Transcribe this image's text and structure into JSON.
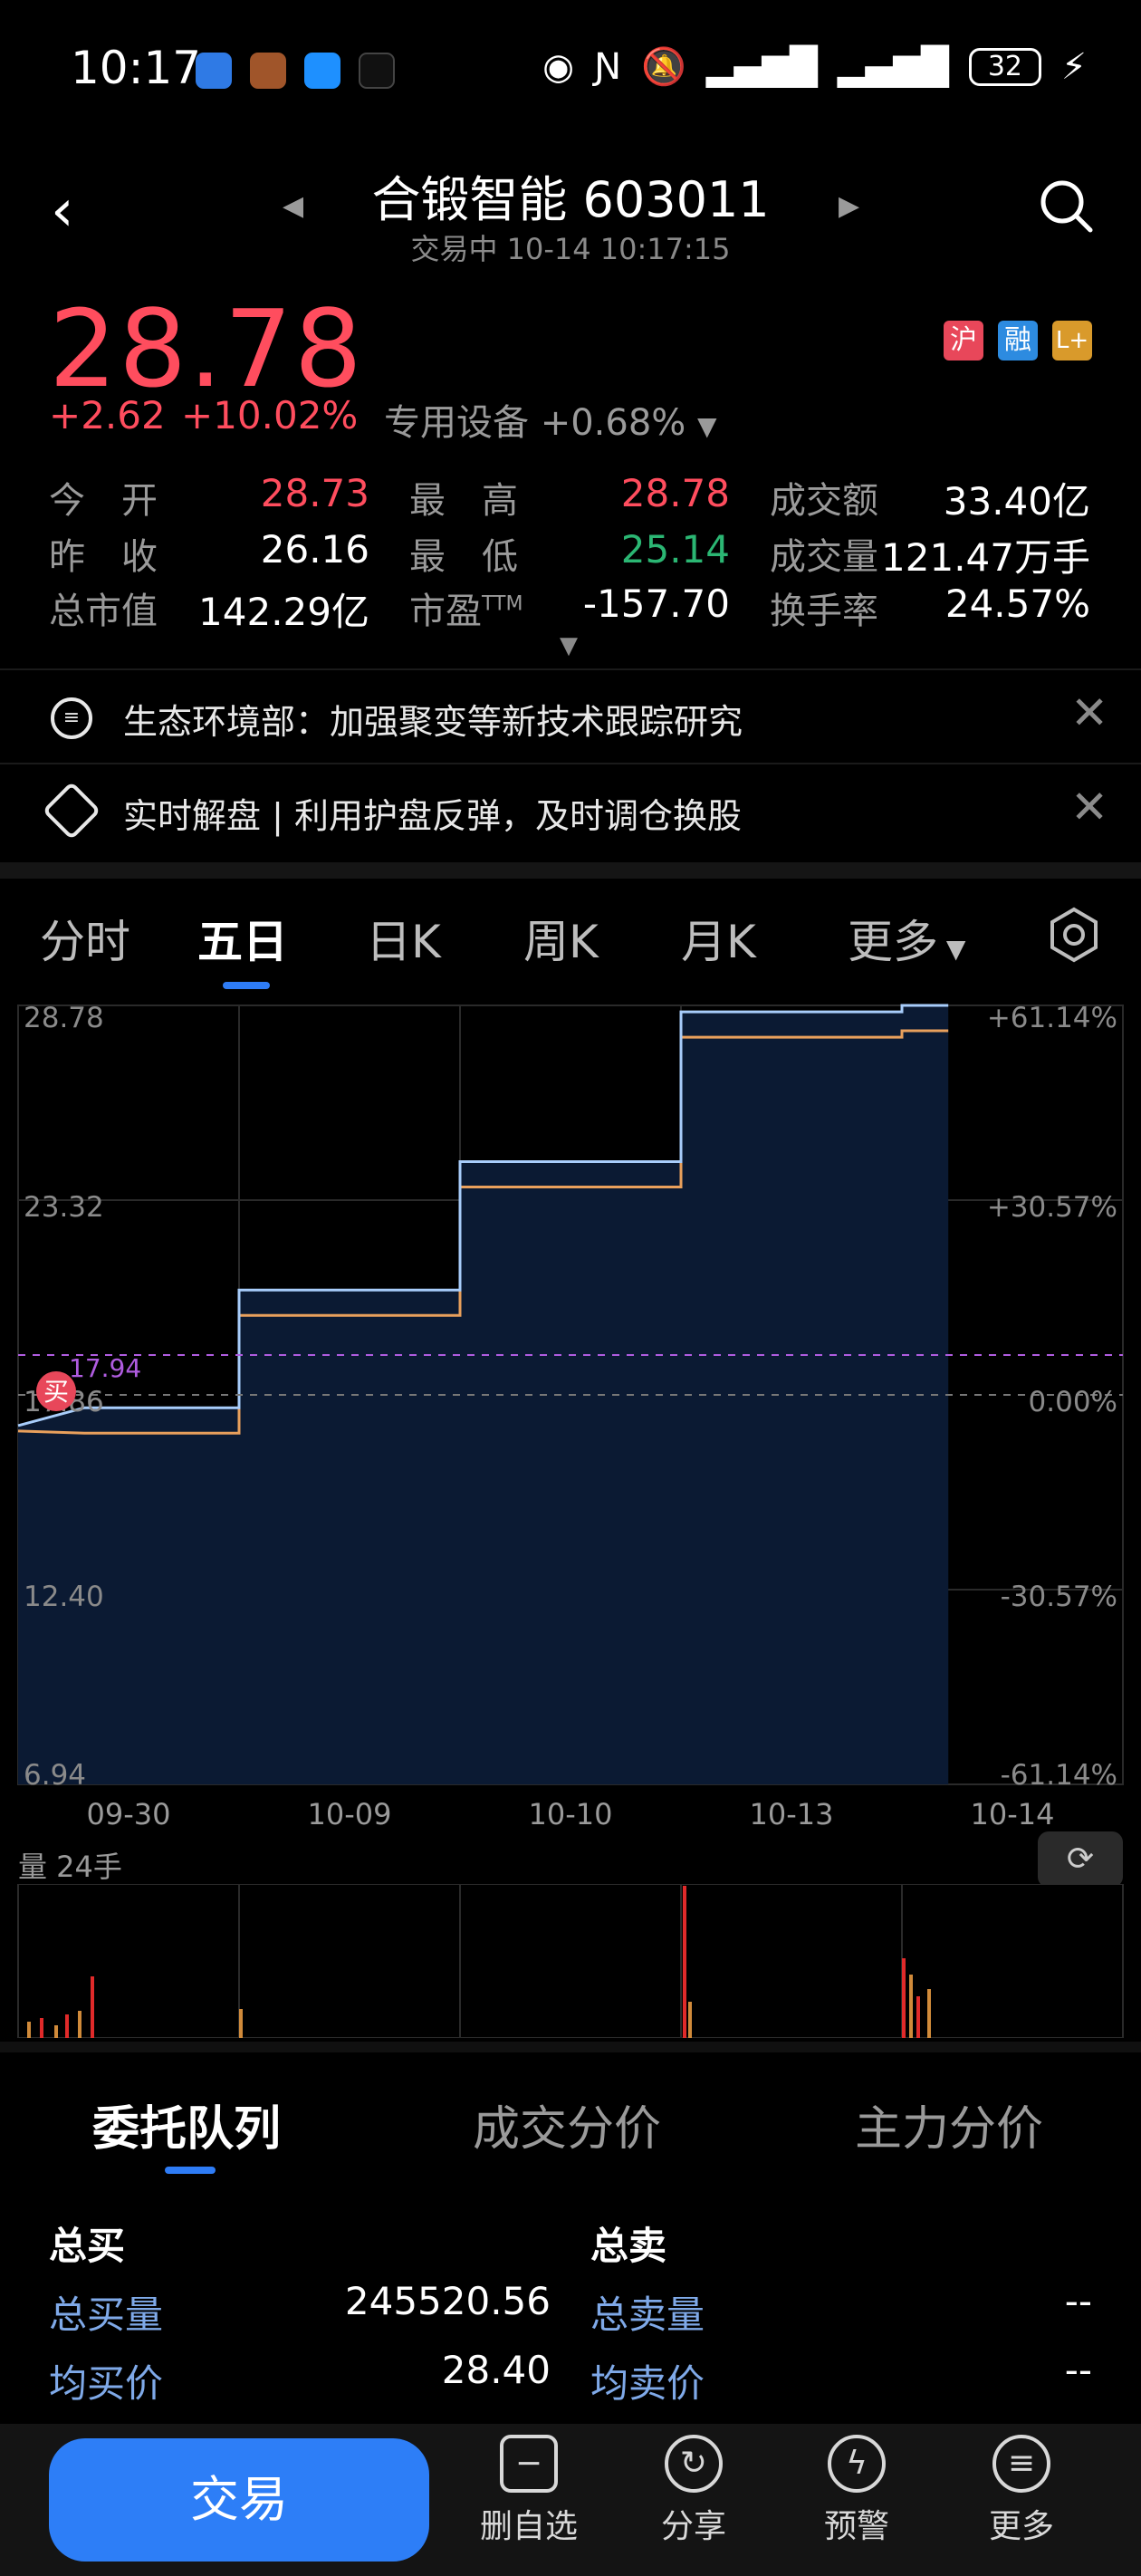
{
  "status": {
    "time": "10:17",
    "battery": "32"
  },
  "header": {
    "name": "合锻智能",
    "code": "603011",
    "subtitle": "交易中 10-14 10:17:15"
  },
  "quote": {
    "price": "28.78",
    "change": "+2.62",
    "change_pct": "+10.02%",
    "sector": "专用设备",
    "sector_pct": "+0.68%",
    "badges": [
      "沪",
      "融",
      "L+"
    ],
    "stats": [
      {
        "label": "今　开",
        "value": "28.73",
        "color": "#ff4d5e"
      },
      {
        "label": "最　高",
        "value": "28.78",
        "color": "#ff4d5e"
      },
      {
        "label": "成交额",
        "value": "33.40亿",
        "color": "#ffffff"
      },
      {
        "label": "昨　收",
        "value": "26.16",
        "color": "#ffffff"
      },
      {
        "label": "最　低",
        "value": "25.14",
        "color": "#2bb673"
      },
      {
        "label": "成交量",
        "value": "121.47万手",
        "color": "#ffffff"
      },
      {
        "label": "总市值",
        "value": "142.29亿",
        "color": "#ffffff"
      },
      {
        "label": "市盈TTM",
        "value": "-157.70",
        "color": "#ffffff"
      },
      {
        "label": "换手率",
        "value": "24.57%",
        "color": "#ffffff"
      }
    ]
  },
  "news": [
    {
      "text": "生态环境部：加强聚变等新技术跟踪研究"
    },
    {
      "text": "实时解盘 | 利用护盘反弹，及时调仓换股"
    }
  ],
  "chart_tabs": [
    "分时",
    "五日",
    "日K",
    "周K",
    "月K",
    "更多"
  ],
  "chart_data": {
    "type": "line",
    "title": "",
    "x": [
      "09-30",
      "10-09",
      "10-10",
      "10-13",
      "10-14"
    ],
    "series": [
      {
        "values": [
          17.5,
          20.8,
          24.4,
          28.6,
          28.78
        ]
      }
    ],
    "y_left_ticks": [
      "28.78",
      "23.32",
      "17.86",
      "12.40",
      "6.94"
    ],
    "y_right_ticks": [
      "+61.14%",
      "+30.57%",
      "0.00%",
      "-30.57%",
      "-61.14%"
    ],
    "ylim": [
      6.94,
      28.78
    ],
    "prev_close": 17.86,
    "buy_marker": "买",
    "buy_price_label": "17.94",
    "volume_label": "量 24手",
    "colors": {
      "price_line": "#a8cdfb",
      "avg_line": "#e9a05c",
      "fill": "#0b1a33",
      "volume_up": "#e02a2a",
      "volume_down": "#d08a3a"
    }
  },
  "book": {
    "tabs": [
      "委托队列",
      "成交分价",
      "主力分价"
    ],
    "buy_title": "总买",
    "sell_title": "总卖",
    "buy_qty_label": "总买量",
    "buy_qty": "245520.56",
    "buy_avg_label": "均买价",
    "buy_avg": "28.40",
    "sell_qty_label": "总卖量",
    "sell_qty": "--",
    "sell_avg_label": "均卖价",
    "sell_avg": "--"
  },
  "bottom_bar": {
    "trade": "交易",
    "tools": [
      "删自选",
      "分享",
      "预警",
      "更多"
    ]
  }
}
